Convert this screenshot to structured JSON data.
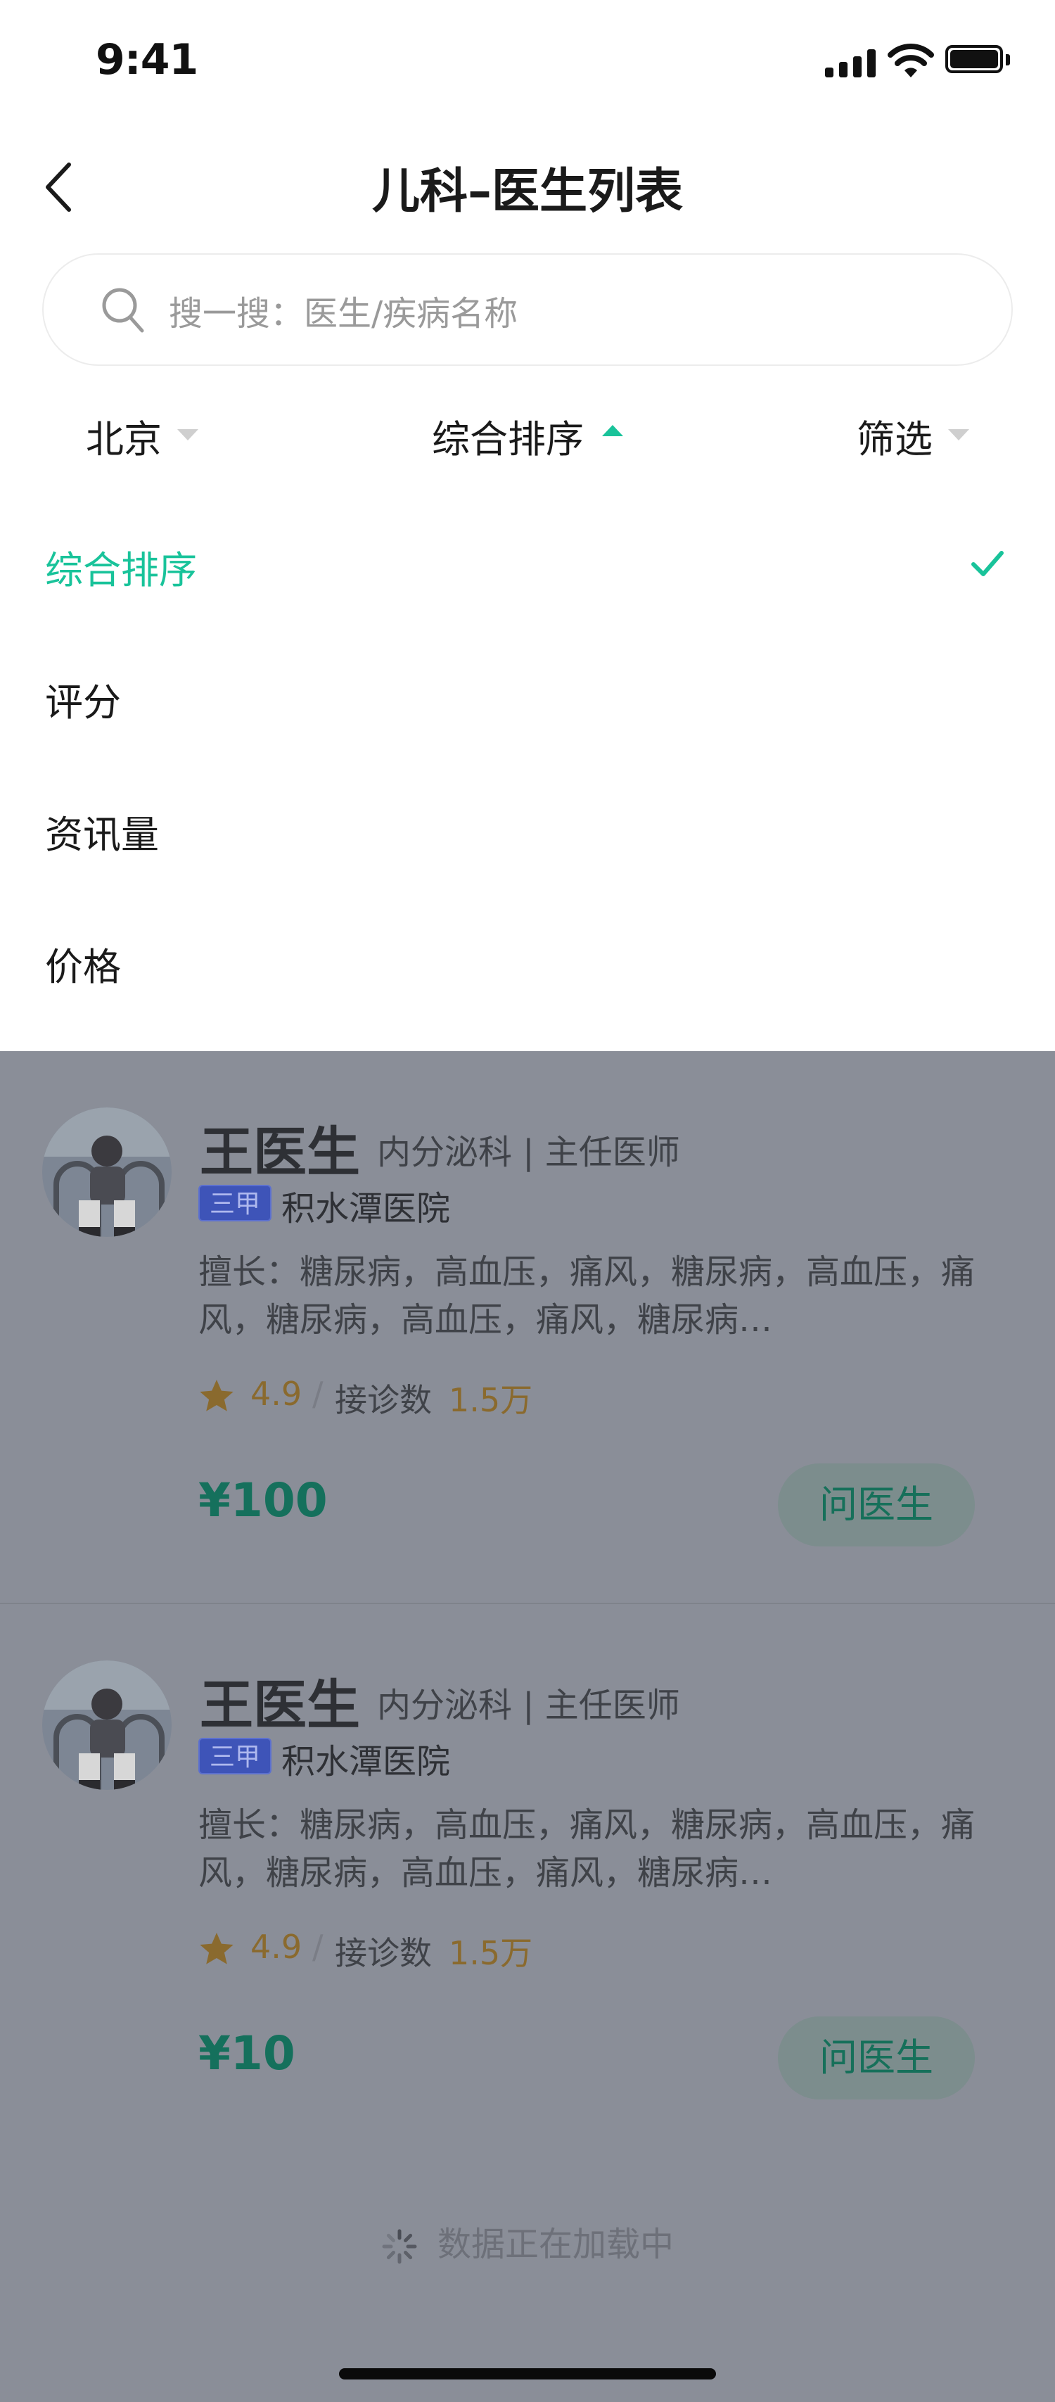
{
  "status_bar": {
    "time": "9:41",
    "icons": [
      "signal-icon",
      "wifi-icon",
      "battery-icon"
    ]
  },
  "header": {
    "back_icon": "chevron-left-icon",
    "title": "儿科–医生列表"
  },
  "search": {
    "icon": "search-icon",
    "placeholder": "搜一搜：医生/疾病名称"
  },
  "filters": [
    {
      "label": "北京",
      "icon": "caret-down-icon"
    },
    {
      "label": "综合排序",
      "icon": "caret-up-icon",
      "active": true
    },
    {
      "label": "筛选",
      "icon": "caret-down-icon"
    }
  ],
  "sort_options": [
    {
      "label": "综合排序",
      "selected": true
    },
    {
      "label": "评分",
      "selected": false
    },
    {
      "label": "资讯量",
      "selected": false
    },
    {
      "label": "价格",
      "selected": false
    }
  ],
  "doctors": [
    {
      "name": "王医生",
      "dept": "内分泌科 | 主任医师",
      "badge": "三甲",
      "hospital": "积水潭医院",
      "expertise": "擅长：糖尿病，高血压，痛风，糖尿病，高血压，痛风，糖尿病，高血压，痛风，糖尿病…",
      "rating": "4.9",
      "separator": "/",
      "visits_label": "接诊数",
      "visits": "1.5万",
      "price": "¥100",
      "ask_label": "问医生"
    },
    {
      "name": "王医生",
      "dept": "内分泌科 | 主任医师",
      "badge": "三甲",
      "hospital": "积水潭医院",
      "expertise": "擅长：糖尿病，高血压，痛风，糖尿病，高血压，痛风，糖尿病，高血压，痛风，糖尿病…",
      "rating": "4.9",
      "separator": "/",
      "visits_label": "接诊数",
      "visits": "1.5万",
      "price": "¥10",
      "ask_label": "问医生"
    }
  ],
  "loading_text": "数据正在加载中",
  "colors": {
    "accent": "#19c39a",
    "overlay": "#8a8e98",
    "price": "#15705c",
    "badge": "#3e54b8"
  }
}
